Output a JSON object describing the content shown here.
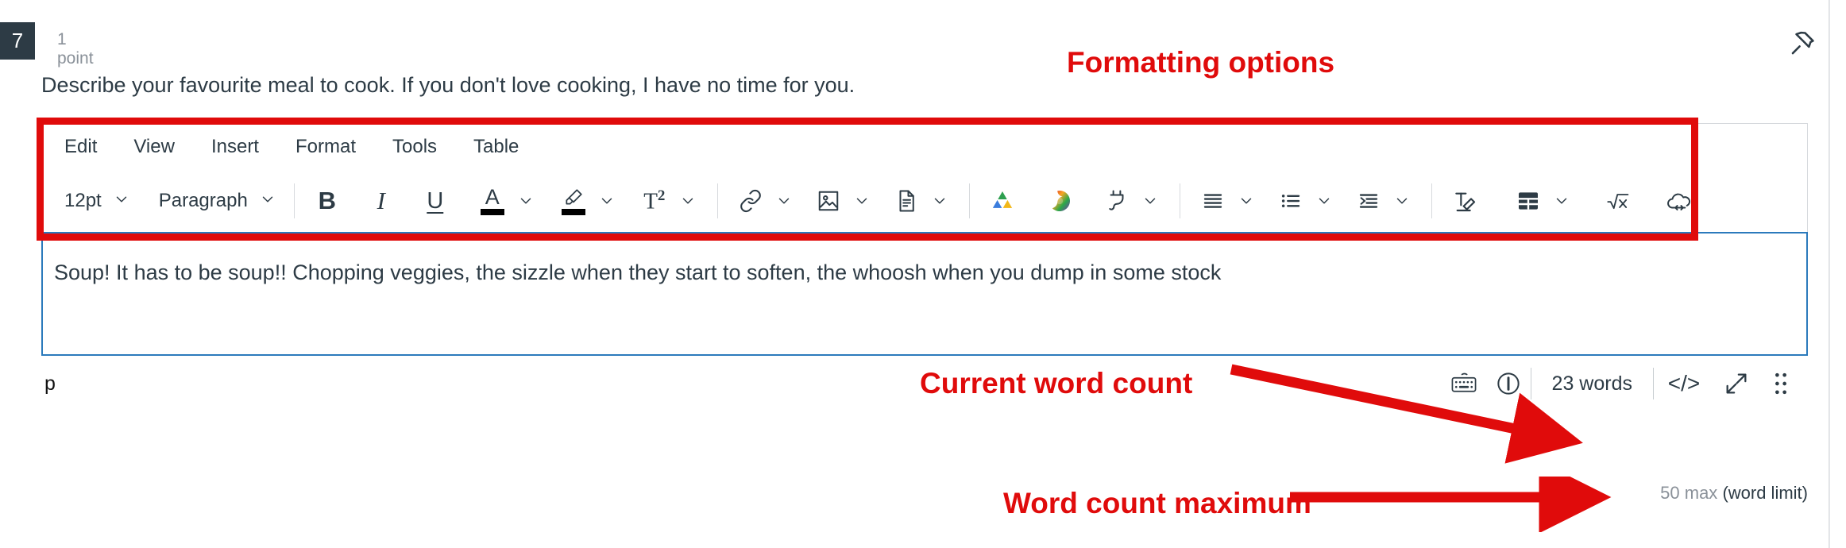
{
  "question": {
    "number": "7",
    "points": "1 point",
    "text": "Describe your favourite meal to cook. If you don't love cooking, I have no time for you."
  },
  "pin": {
    "icon": "pin-icon"
  },
  "editor": {
    "menubar": [
      {
        "label": "Edit"
      },
      {
        "label": "View"
      },
      {
        "label": "Insert"
      },
      {
        "label": "Format"
      },
      {
        "label": "Tools"
      },
      {
        "label": "Table"
      }
    ],
    "toolbar": {
      "font_size": "12pt",
      "block_format": "Paragraph",
      "bold": "B",
      "italic": "I",
      "underline": "U",
      "text_color": "A",
      "highlight": "highlighter-icon",
      "superscript": "T",
      "superscript_exp": "2",
      "link": "link-icon",
      "image": "image-icon",
      "document": "document-icon",
      "google_drive": "google-drive-icon",
      "swirl": "rainbow-swirl-icon",
      "apps": "plug-icon",
      "align": "align-left-icon",
      "bullet_list": "bullet-list-icon",
      "indent": "indent-icon",
      "clear_formatting": "clear-formatting-icon",
      "table": "table-icon",
      "math": "math-icon",
      "embed": "cloud-code-icon"
    },
    "body_text": "Soup! It has to be soup!! Chopping veggies, the sizzle when they start to soften, the whoosh when you dump in some stock",
    "statusbar": {
      "path": "p",
      "keyboard": "keyboard-icon",
      "accessibility": "accessibility-checker-icon",
      "word_count": "23 words",
      "html_editor": "</>",
      "fullscreen": "fullscreen-icon",
      "resize": "resize-handle-icon"
    },
    "word_limit": {
      "max": "50 max",
      "label": "(word limit)"
    }
  },
  "annotations": {
    "formatting": "Formatting options",
    "word_count": "Current word count",
    "word_max": "Word count maximum"
  },
  "colors": {
    "annotation_red": "#e00b0b",
    "editor_border_blue": "#2b7abc",
    "dark": "#2d3b45",
    "muted": "#8a9199"
  }
}
